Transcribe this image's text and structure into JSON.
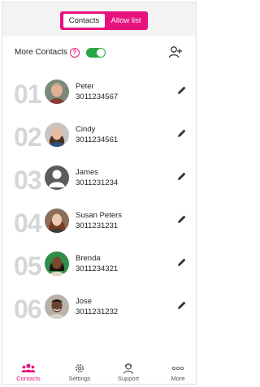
{
  "header": {
    "tabs": [
      {
        "label": "Contacts",
        "active": true
      },
      {
        "label": "Allow list",
        "active": false
      }
    ]
  },
  "more_contacts": {
    "label": "More Contacts",
    "help_glyph": "?",
    "toggle_on": true
  },
  "contacts": [
    {
      "index": "01",
      "name": "Peter",
      "phone": "3011234567",
      "avatar": "avatar-photo"
    },
    {
      "index": "02",
      "name": "Cindy",
      "phone": "3011234561",
      "avatar": "avatar-photo"
    },
    {
      "index": "03",
      "name": "James",
      "phone": "3011231234",
      "avatar": "avatar-placeholder"
    },
    {
      "index": "04",
      "name": "Susan Peters",
      "phone": "3011231231",
      "avatar": "avatar-photo"
    },
    {
      "index": "05",
      "name": "Brenda",
      "phone": "3011234321",
      "avatar": "avatar-photo"
    },
    {
      "index": "06",
      "name": "Jose",
      "phone": "3011231232",
      "avatar": "avatar-photo"
    }
  ],
  "nav": {
    "items": [
      {
        "label": "Contacts",
        "icon": "people-icon",
        "active": true
      },
      {
        "label": "Settings",
        "icon": "gear-icon",
        "active": false
      },
      {
        "label": "Support",
        "icon": "support-icon",
        "active": false
      },
      {
        "label": "More",
        "icon": "more-icon",
        "active": false
      }
    ]
  },
  "colors": {
    "accent": "#e8127e",
    "toggle_on": "#28a745",
    "index_number": "#d6d6d6"
  }
}
